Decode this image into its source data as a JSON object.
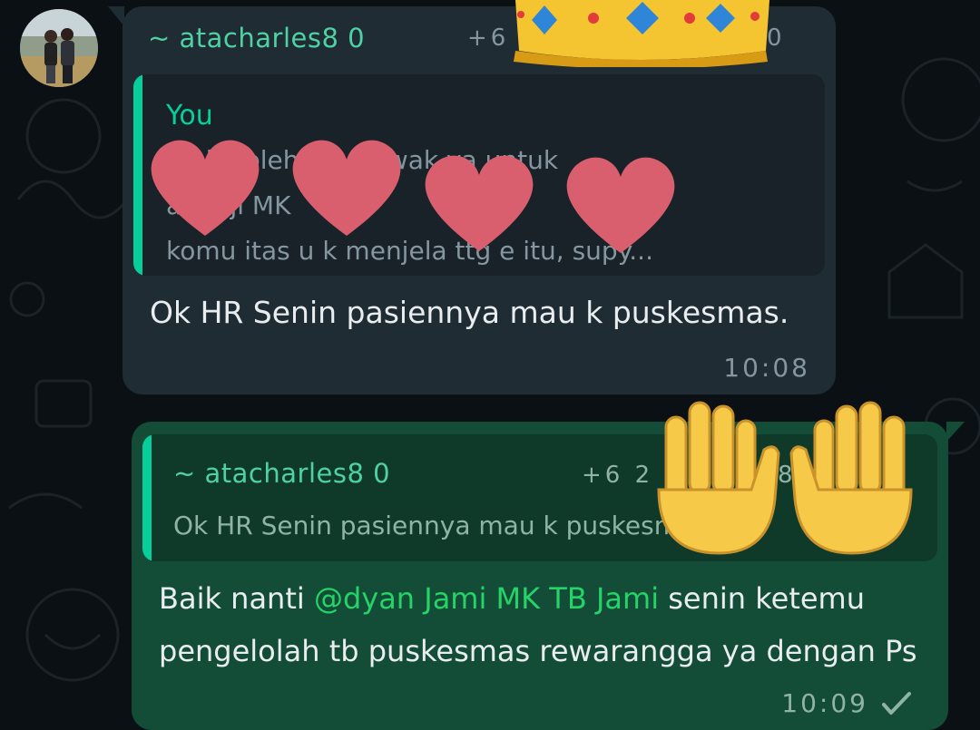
{
  "colors": {
    "wallpaper": "#0b1014",
    "incoming_bubble": "#1f2c34",
    "outgoing_bubble": "#134d37",
    "accent": "#06cf9c",
    "mention": "#25d366",
    "heart": "#d95f6e"
  },
  "incoming": {
    "sender": "~ atacharles8 0",
    "phone_partial": "+6 2",
    "phone_tail": "0",
    "quote": {
      "author": "You",
      "lines": [
        "Th       k     boleh bu mi     wak     ya untuk",
        "          an                 h          ji          MK",
        "komu   itas u      k menjela     ttg e        itu, supy..."
      ]
    },
    "text": "Ok HR Senin pasiennya mau k puskesmas.",
    "time": "10:08"
  },
  "outgoing": {
    "quote": {
      "author": "~ atacharles8 0",
      "phone_partial": "+6 2",
      "phone_tail": "8",
      "text": "Ok HR Senin pasiennya mau k puskesmas."
    },
    "text_line1_prefix": "Baik nanti ",
    "mention": "@dyan Jami MK TB Jami",
    "text_line1_suffix": " senin ketemu",
    "text_line2": "pengelolah tb puskesmas rewarangga ya dengan Ps",
    "time": "10:09",
    "status_icon": "double-check-icon"
  },
  "stickers": [
    "crown-icon",
    "heart-icon",
    "heart-icon",
    "heart-icon",
    "heart-icon",
    "raised-hand-icon",
    "raised-hand-icon"
  ]
}
